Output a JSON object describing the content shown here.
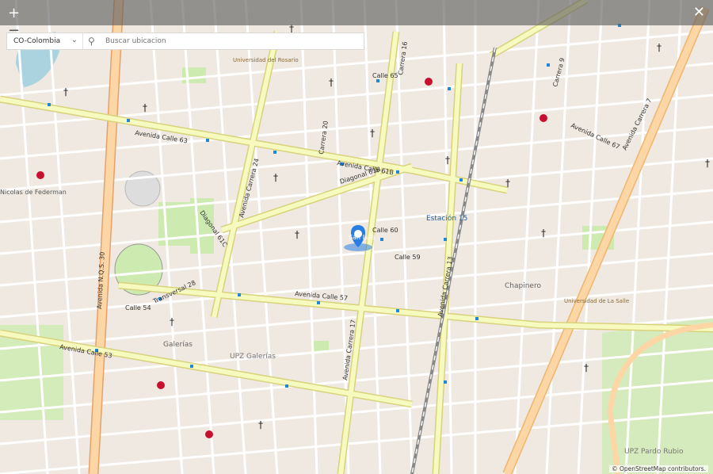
{
  "toolbar": {
    "zoom_in_label": "+",
    "zoom_out_label": "−",
    "close_label": "✕"
  },
  "search": {
    "country_value": "CO-Colombia",
    "placeholder": "Buscar ubicacion"
  },
  "attribution": "© OpenStreetMap contributors.",
  "marker": {
    "label": "San Luis",
    "color": "#2a7de1"
  },
  "map_labels": {
    "avenida_calle_63": "Avenida Calle 63",
    "avenida_calle_61b": "Avenida Calle 61B",
    "avenida_calle_57": "Avenida Calle 57",
    "avenida_calle_53": "Avenida Calle 53",
    "avenida_nqs": "Avenida N.Q.S. 30",
    "avenida_carrera_24": "Avenida Carrera 24",
    "avenida_carrera_17": "Avenida Carrera 17",
    "avenida_carrera_13": "Avenida Carrera 13",
    "avenida_carrera_7": "Avenida Carrera 7",
    "avenida_calle_67": "Avenida Calle 67",
    "diagonal_61b": "Diagonal 61B",
    "diagonal_61c": "Diagonal 61C",
    "transversal_28": "Transversal 28",
    "estacion_15": "Estación 15",
    "chapinero": "Chapinero",
    "upz_galerias": "UPZ Galerías",
    "galerias": "Galerías",
    "upz_pardo_rubio": "UPZ Pardo Rubio",
    "universidad_rosario": "Universidad del Rosario",
    "universidad_salle": "Universidad de La Salle",
    "nicolas_federman": "Nicolas de Federman",
    "calle_54": "Calle 54",
    "calle_59": "Calle 59",
    "calle_60": "Calle 60",
    "calle_65": "Calle 65",
    "carrera_20": "Carrera 20",
    "carrera_16": "Carrera 16",
    "carrera_9": "Carrera 9"
  },
  "colors": {
    "map_bg": "#efe9e1",
    "major_road": "#f7fabf",
    "arterial_road": "#fcd6a4",
    "residential_road": "#ffffff",
    "park": "#cdebb0",
    "water": "#aad3df",
    "railway": "#888888",
    "bus_stop": "#1e88d6",
    "church": "#222222",
    "hospital": "#c8102e"
  }
}
